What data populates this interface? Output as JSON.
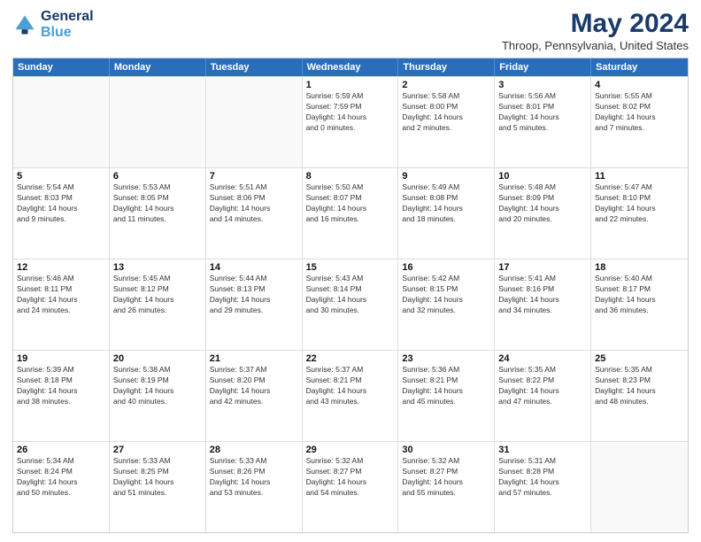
{
  "header": {
    "logo_line1": "General",
    "logo_line2": "Blue",
    "main_title": "May 2024",
    "subtitle": "Throop, Pennsylvania, United States"
  },
  "days_of_week": [
    "Sunday",
    "Monday",
    "Tuesday",
    "Wednesday",
    "Thursday",
    "Friday",
    "Saturday"
  ],
  "weeks": [
    [
      {
        "day": "",
        "content": [],
        "empty": true
      },
      {
        "day": "",
        "content": [],
        "empty": true
      },
      {
        "day": "",
        "content": [],
        "empty": true
      },
      {
        "day": "1",
        "content": [
          "Sunrise: 5:59 AM",
          "Sunset: 7:59 PM",
          "Daylight: 14 hours",
          "and 0 minutes."
        ],
        "empty": false
      },
      {
        "day": "2",
        "content": [
          "Sunrise: 5:58 AM",
          "Sunset: 8:00 PM",
          "Daylight: 14 hours",
          "and 2 minutes."
        ],
        "empty": false
      },
      {
        "day": "3",
        "content": [
          "Sunrise: 5:56 AM",
          "Sunset: 8:01 PM",
          "Daylight: 14 hours",
          "and 5 minutes."
        ],
        "empty": false
      },
      {
        "day": "4",
        "content": [
          "Sunrise: 5:55 AM",
          "Sunset: 8:02 PM",
          "Daylight: 14 hours",
          "and 7 minutes."
        ],
        "empty": false
      }
    ],
    [
      {
        "day": "5",
        "content": [
          "Sunrise: 5:54 AM",
          "Sunset: 8:03 PM",
          "Daylight: 14 hours",
          "and 9 minutes."
        ],
        "empty": false
      },
      {
        "day": "6",
        "content": [
          "Sunrise: 5:53 AM",
          "Sunset: 8:05 PM",
          "Daylight: 14 hours",
          "and 11 minutes."
        ],
        "empty": false
      },
      {
        "day": "7",
        "content": [
          "Sunrise: 5:51 AM",
          "Sunset: 8:06 PM",
          "Daylight: 14 hours",
          "and 14 minutes."
        ],
        "empty": false
      },
      {
        "day": "8",
        "content": [
          "Sunrise: 5:50 AM",
          "Sunset: 8:07 PM",
          "Daylight: 14 hours",
          "and 16 minutes."
        ],
        "empty": false
      },
      {
        "day": "9",
        "content": [
          "Sunrise: 5:49 AM",
          "Sunset: 8:08 PM",
          "Daylight: 14 hours",
          "and 18 minutes."
        ],
        "empty": false
      },
      {
        "day": "10",
        "content": [
          "Sunrise: 5:48 AM",
          "Sunset: 8:09 PM",
          "Daylight: 14 hours",
          "and 20 minutes."
        ],
        "empty": false
      },
      {
        "day": "11",
        "content": [
          "Sunrise: 5:47 AM",
          "Sunset: 8:10 PM",
          "Daylight: 14 hours",
          "and 22 minutes."
        ],
        "empty": false
      }
    ],
    [
      {
        "day": "12",
        "content": [
          "Sunrise: 5:46 AM",
          "Sunset: 8:11 PM",
          "Daylight: 14 hours",
          "and 24 minutes."
        ],
        "empty": false
      },
      {
        "day": "13",
        "content": [
          "Sunrise: 5:45 AM",
          "Sunset: 8:12 PM",
          "Daylight: 14 hours",
          "and 26 minutes."
        ],
        "empty": false
      },
      {
        "day": "14",
        "content": [
          "Sunrise: 5:44 AM",
          "Sunset: 8:13 PM",
          "Daylight: 14 hours",
          "and 29 minutes."
        ],
        "empty": false
      },
      {
        "day": "15",
        "content": [
          "Sunrise: 5:43 AM",
          "Sunset: 8:14 PM",
          "Daylight: 14 hours",
          "and 30 minutes."
        ],
        "empty": false
      },
      {
        "day": "16",
        "content": [
          "Sunrise: 5:42 AM",
          "Sunset: 8:15 PM",
          "Daylight: 14 hours",
          "and 32 minutes."
        ],
        "empty": false
      },
      {
        "day": "17",
        "content": [
          "Sunrise: 5:41 AM",
          "Sunset: 8:16 PM",
          "Daylight: 14 hours",
          "and 34 minutes."
        ],
        "empty": false
      },
      {
        "day": "18",
        "content": [
          "Sunrise: 5:40 AM",
          "Sunset: 8:17 PM",
          "Daylight: 14 hours",
          "and 36 minutes."
        ],
        "empty": false
      }
    ],
    [
      {
        "day": "19",
        "content": [
          "Sunrise: 5:39 AM",
          "Sunset: 8:18 PM",
          "Daylight: 14 hours",
          "and 38 minutes."
        ],
        "empty": false
      },
      {
        "day": "20",
        "content": [
          "Sunrise: 5:38 AM",
          "Sunset: 8:19 PM",
          "Daylight: 14 hours",
          "and 40 minutes."
        ],
        "empty": false
      },
      {
        "day": "21",
        "content": [
          "Sunrise: 5:37 AM",
          "Sunset: 8:20 PM",
          "Daylight: 14 hours",
          "and 42 minutes."
        ],
        "empty": false
      },
      {
        "day": "22",
        "content": [
          "Sunrise: 5:37 AM",
          "Sunset: 8:21 PM",
          "Daylight: 14 hours",
          "and 43 minutes."
        ],
        "empty": false
      },
      {
        "day": "23",
        "content": [
          "Sunrise: 5:36 AM",
          "Sunset: 8:21 PM",
          "Daylight: 14 hours",
          "and 45 minutes."
        ],
        "empty": false
      },
      {
        "day": "24",
        "content": [
          "Sunrise: 5:35 AM",
          "Sunset: 8:22 PM",
          "Daylight: 14 hours",
          "and 47 minutes."
        ],
        "empty": false
      },
      {
        "day": "25",
        "content": [
          "Sunrise: 5:35 AM",
          "Sunset: 8:23 PM",
          "Daylight: 14 hours",
          "and 48 minutes."
        ],
        "empty": false
      }
    ],
    [
      {
        "day": "26",
        "content": [
          "Sunrise: 5:34 AM",
          "Sunset: 8:24 PM",
          "Daylight: 14 hours",
          "and 50 minutes."
        ],
        "empty": false
      },
      {
        "day": "27",
        "content": [
          "Sunrise: 5:33 AM",
          "Sunset: 8:25 PM",
          "Daylight: 14 hours",
          "and 51 minutes."
        ],
        "empty": false
      },
      {
        "day": "28",
        "content": [
          "Sunrise: 5:33 AM",
          "Sunset: 8:26 PM",
          "Daylight: 14 hours",
          "and 53 minutes."
        ],
        "empty": false
      },
      {
        "day": "29",
        "content": [
          "Sunrise: 5:32 AM",
          "Sunset: 8:27 PM",
          "Daylight: 14 hours",
          "and 54 minutes."
        ],
        "empty": false
      },
      {
        "day": "30",
        "content": [
          "Sunrise: 5:32 AM",
          "Sunset: 8:27 PM",
          "Daylight: 14 hours",
          "and 55 minutes."
        ],
        "empty": false
      },
      {
        "day": "31",
        "content": [
          "Sunrise: 5:31 AM",
          "Sunset: 8:28 PM",
          "Daylight: 14 hours",
          "and 57 minutes."
        ],
        "empty": false
      },
      {
        "day": "",
        "content": [],
        "empty": true
      }
    ]
  ]
}
